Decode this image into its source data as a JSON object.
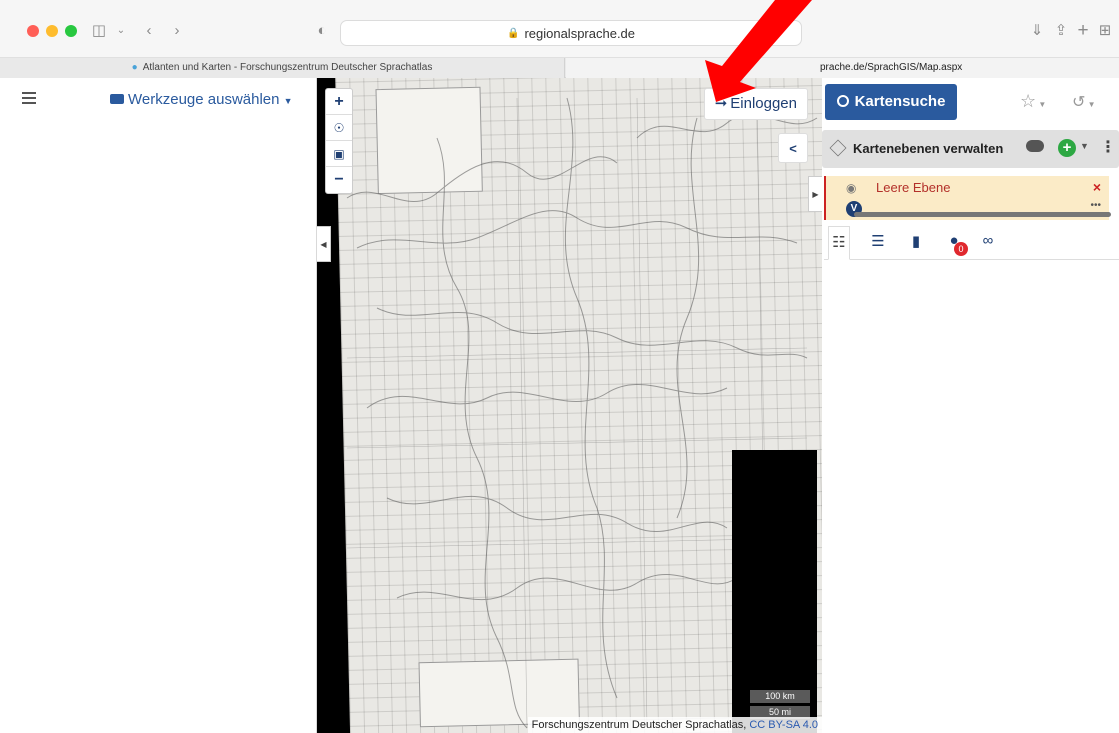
{
  "browser": {
    "address": "regionalsprache.de",
    "tabs": [
      {
        "label": "Atlanten und Karten - Forschungszentrum Deutscher Sprachatlas"
      },
      {
        "label": "prache.de/SprachGIS/Map.aspx"
      }
    ]
  },
  "left_panel": {
    "tools_label": "Werkzeuge auswählen"
  },
  "map": {
    "login_label": "Einloggen",
    "scale_km": "100 km",
    "scale_mi": "50 mi",
    "attribution_text": "Forschungszentrum Deutscher Sprachatlas, ",
    "attribution_license": "CC BY-SA 4.0"
  },
  "right_panel": {
    "search_label": "Kartensuche",
    "layers_manage_label": "Kartenebenen verwalten",
    "layer_name": "Leere Ebene",
    "layer_badge": "V",
    "marker_count": "0"
  },
  "colors": {
    "primary": "#2a5a9e",
    "arrow": "#ff0000",
    "layer_bg": "#fbebc7"
  }
}
